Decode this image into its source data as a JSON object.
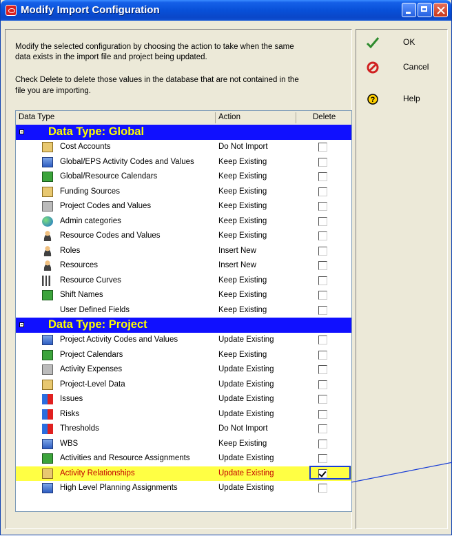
{
  "window": {
    "title": "Modify Import Configuration"
  },
  "instructions": {
    "line1": "Modify the selected configuration by choosing the action to take when the same",
    "line2": "data exists in the import file and project being updated.",
    "line3": "Check Delete to delete those values in the database that are not contained in the",
    "line4": "file you are importing."
  },
  "grid": {
    "headers": {
      "data_type": "Data Type",
      "action": "Action",
      "delete": "Delete"
    },
    "groups": [
      {
        "label": "Data Type: Global",
        "rows": [
          {
            "name": "Cost Accounts",
            "action": "Do Not Import",
            "delete": false,
            "icon": "folder-icon"
          },
          {
            "name": "Global/EPS Activity Codes and Values",
            "action": "Keep Existing",
            "delete": false,
            "icon": "codes-icon"
          },
          {
            "name": "Global/Resource Calendars",
            "action": "Keep Existing",
            "delete": false,
            "icon": "calendar-icon"
          },
          {
            "name": "Funding Sources",
            "action": "Keep Existing",
            "delete": false,
            "icon": "folder-icon"
          },
          {
            "name": "Project Codes and Values",
            "action": "Keep Existing",
            "delete": false,
            "icon": "project-codes-icon"
          },
          {
            "name": "Admin categories",
            "action": "Keep Existing",
            "delete": false,
            "icon": "globe-icon"
          },
          {
            "name": "Resource Codes and Values",
            "action": "Keep Existing",
            "delete": false,
            "icon": "resource-codes-icon"
          },
          {
            "name": "Roles",
            "action": "Insert New",
            "delete": false,
            "icon": "role-icon"
          },
          {
            "name": "Resources",
            "action": "Insert New",
            "delete": false,
            "icon": "person-icon"
          },
          {
            "name": "Resource Curves",
            "action": "Keep Existing",
            "delete": false,
            "icon": "chart-icon"
          },
          {
            "name": "Shift Names",
            "action": "Keep Existing",
            "delete": false,
            "icon": "calendar-icon"
          },
          {
            "name": "User Defined Fields",
            "action": "Keep Existing",
            "delete": false,
            "icon": ""
          }
        ]
      },
      {
        "label": "Data Type: Project",
        "rows": [
          {
            "name": "Project Activity Codes and Values",
            "action": "Update Existing",
            "delete": false,
            "icon": "codes-icon"
          },
          {
            "name": "Project Calendars",
            "action": "Keep Existing",
            "delete": false,
            "icon": "calendar-icon"
          },
          {
            "name": "Activity Expenses",
            "action": "Update Existing",
            "delete": false,
            "icon": "expenses-icon"
          },
          {
            "name": "Project-Level Data",
            "action": "Update Existing",
            "delete": false,
            "icon": "folder-icon"
          },
          {
            "name": "Issues",
            "action": "Update Existing",
            "delete": false,
            "icon": "issues-icon"
          },
          {
            "name": "Risks",
            "action": "Update Existing",
            "delete": false,
            "icon": "risks-icon"
          },
          {
            "name": "Thresholds",
            "action": "Do Not Import",
            "delete": false,
            "icon": "thresholds-icon"
          },
          {
            "name": "WBS",
            "action": "Keep Existing",
            "delete": false,
            "icon": "wbs-icon"
          },
          {
            "name": "Activities and Resource Assignments",
            "action": "Update Existing",
            "delete": false,
            "icon": "activities-icon"
          },
          {
            "name": "Activity Relationships",
            "action": "Update Existing",
            "delete": true,
            "icon": "relationships-icon",
            "selected": true
          },
          {
            "name": "High Level Planning Assignments",
            "action": "Update Existing",
            "delete": false,
            "icon": "planning-icon"
          }
        ]
      }
    ]
  },
  "buttons": {
    "ok": "OK",
    "cancel": "Cancel",
    "help": "Help"
  },
  "colors": {
    "group_band": "#1010ff",
    "group_text": "#ffff00",
    "selected_row": "#ffff44",
    "selected_text": "#c40000"
  }
}
